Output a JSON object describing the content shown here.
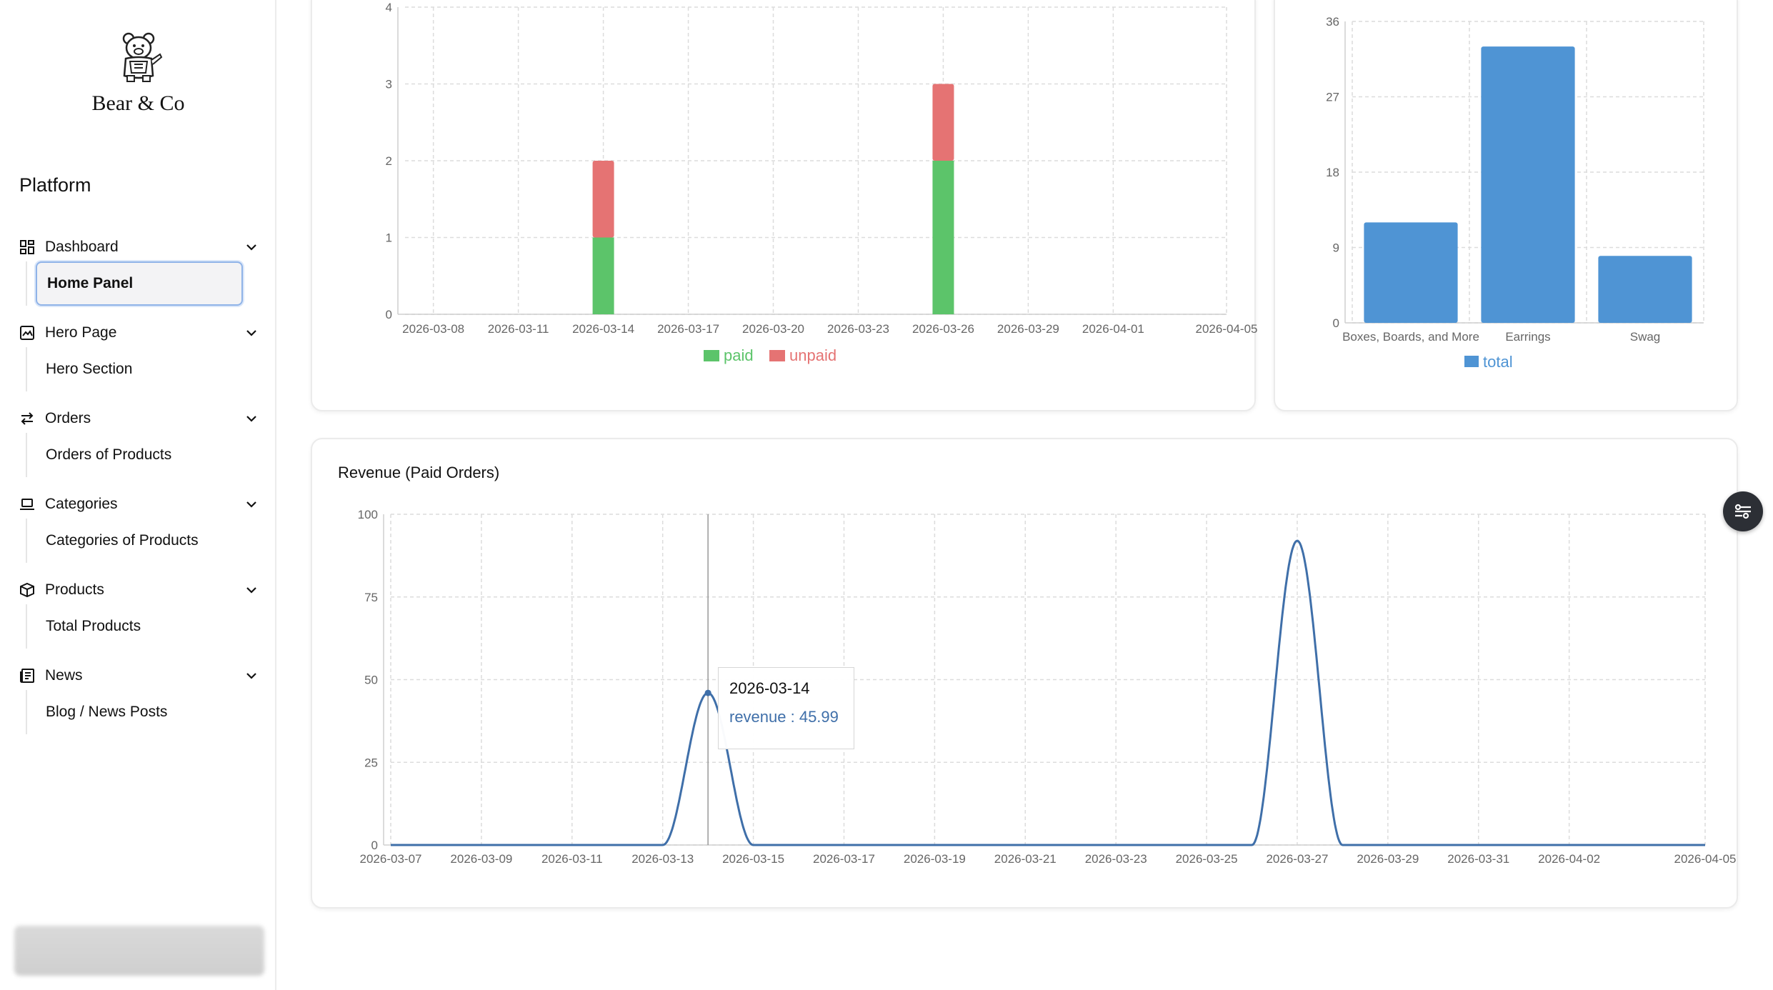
{
  "brand": {
    "name": "Bear & Co",
    "logo_icon": "bear-mascot-icon"
  },
  "sidebar": {
    "section_title": "Platform",
    "groups": [
      {
        "label": "Dashboard",
        "icon": "dashboard-grid-icon",
        "sub": "Home Panel",
        "active": true
      },
      {
        "label": "Hero Page",
        "icon": "image-frame-icon",
        "sub": "Hero Section"
      },
      {
        "label": "Orders",
        "icon": "swap-arrows-icon",
        "sub": "Orders of Products"
      },
      {
        "label": "Categories",
        "icon": "laptop-icon",
        "sub": "Categories of Products"
      },
      {
        "label": "Products",
        "icon": "package-icon",
        "sub": "Total Products"
      },
      {
        "label": "News",
        "icon": "newspaper-icon",
        "sub": "Blog / News Posts"
      }
    ]
  },
  "colors": {
    "paid": "#5cc46a",
    "unpaid": "#e57373",
    "total": "#4f94d4",
    "revenue": "#3f6fa9",
    "active_border": "#8fb3e8"
  },
  "chart_data": [
    {
      "type": "bar",
      "stacked": true,
      "categories": [
        "2026-03-08",
        "2026-03-11",
        "2026-03-14",
        "2026-03-17",
        "2026-03-20",
        "2026-03-23",
        "2026-03-26",
        "2026-03-29",
        "2026-04-01",
        "2026-04-05"
      ],
      "x_ticks": [
        "2026-03-08",
        "2026-03-11",
        "2026-03-14",
        "2026-03-17",
        "2026-03-20",
        "2026-03-23",
        "2026-03-26",
        "2026-03-29",
        "2026-04-01",
        "2026-04-05"
      ],
      "series": [
        {
          "name": "paid",
          "points": [
            {
              "x": "2026-03-14",
              "y": 1
            },
            {
              "x": "2026-03-26",
              "y": 2
            }
          ]
        },
        {
          "name": "unpaid",
          "points": [
            {
              "x": "2026-03-14",
              "y": 1
            },
            {
              "x": "2026-03-26",
              "y": 1
            }
          ]
        }
      ],
      "y_ticks": [
        0,
        1,
        2,
        3,
        4
      ],
      "ylim": [
        0,
        4
      ],
      "grid": true,
      "legend": "bottom-center"
    },
    {
      "type": "bar",
      "categories": [
        "Boxes, Boards, and More",
        "Earrings",
        "Swag"
      ],
      "series": [
        {
          "name": "total",
          "values": [
            12,
            33,
            8
          ]
        }
      ],
      "y_ticks": [
        0,
        9,
        18,
        27,
        36
      ],
      "ylim": [
        0,
        36
      ],
      "grid": true,
      "legend": "bottom-center"
    },
    {
      "type": "line",
      "title": "Revenue (Paid Orders)",
      "x_ticks": [
        "2026-03-07",
        "2026-03-09",
        "2026-03-11",
        "2026-03-13",
        "2026-03-15",
        "2026-03-17",
        "2026-03-19",
        "2026-03-21",
        "2026-03-23",
        "2026-03-25",
        "2026-03-27",
        "2026-03-29",
        "2026-03-31",
        "2026-04-02",
        "2026-04-05"
      ],
      "series": [
        {
          "name": "revenue",
          "points": [
            {
              "x": "2026-03-14",
              "y": 45.99
            },
            {
              "x": "2026-03-27",
              "y": 92
            }
          ]
        }
      ],
      "y_ticks": [
        0,
        25,
        50,
        75,
        100
      ],
      "ylim": [
        0,
        100
      ],
      "grid": true,
      "tooltip": {
        "date": "2026-03-14",
        "text": "revenue : 45.99"
      }
    }
  ],
  "fab": {
    "icon": "filter-list-icon"
  }
}
